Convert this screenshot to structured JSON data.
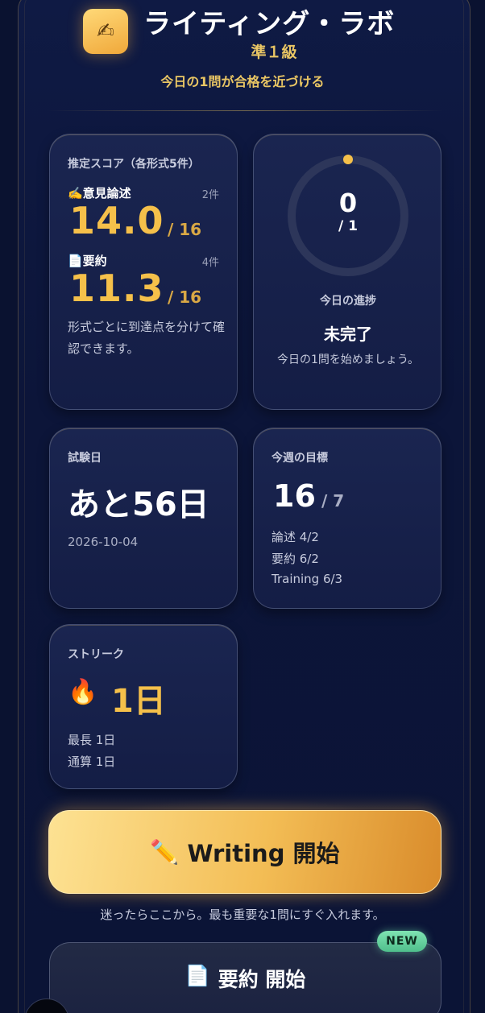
{
  "header": {
    "logo_icon": "writing-hand-icon",
    "logo_glyph": "✍",
    "title": "ライティング・ラボ",
    "grade": "準１級",
    "tagline": "今日の1問が合格を近づける"
  },
  "score_card": {
    "label": "推定スコア（各形式5件）",
    "rows": [
      {
        "label": "✍️意見論述",
        "count": "2件",
        "score": "14.0",
        "max": "/ 16"
      },
      {
        "label": "📄要約",
        "count": "4件",
        "score": "11.3",
        "max": "/ 16"
      }
    ],
    "note": "形式ごとに到達点を分けて確認できます。"
  },
  "progress_card": {
    "done": "0",
    "total": "/ 1",
    "progress_fraction": 0,
    "label": "今日の進捗",
    "status": "未完了",
    "message": "今日の1問を始めましょう。"
  },
  "exam_card": {
    "label": "試験日",
    "countdown": "あと56日",
    "date": "2026-10-04"
  },
  "weekly_card": {
    "label": "今週の目標",
    "value": "16",
    "max": "/ 7",
    "lines": [
      "論述 4/2",
      "要約 6/2",
      "Training 6/3"
    ]
  },
  "streak_card": {
    "label": "ストリーク",
    "icon": "fire-icon",
    "icon_glyph": "🔥",
    "value": "1日",
    "lines": [
      "最長 1日",
      "通算 1日"
    ]
  },
  "cta": {
    "icon": "pencil-icon",
    "icon_glyph": "✏️",
    "label": "Writing 開始",
    "note": "迷ったらここから。最も重要な1問にすぐ入れます。"
  },
  "secondary": {
    "icon": "document-icon",
    "icon_glyph": "📄",
    "label": "要約 開始",
    "badge": "NEW"
  },
  "colors": {
    "background": "#0a1230",
    "accent_gold": "#f5c04a",
    "badge_green": "#4fbf8c"
  }
}
